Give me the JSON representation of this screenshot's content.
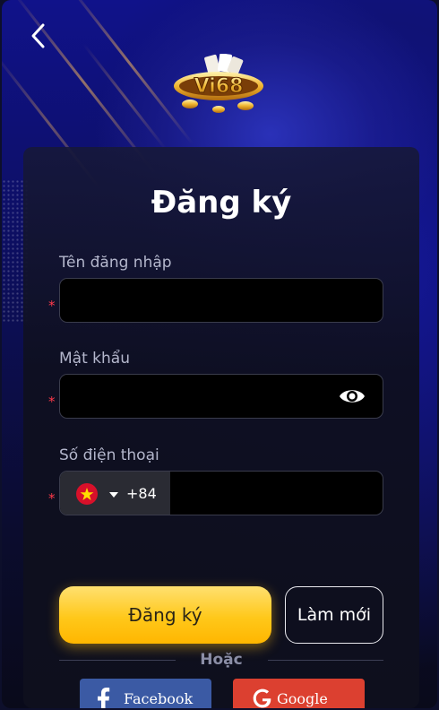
{
  "header": {
    "back_icon": "chevron-left-icon",
    "logo_text": "Vi68"
  },
  "form": {
    "title": "Đăng ký",
    "username": {
      "label": "Tên đăng nhập",
      "value": "",
      "placeholder": ""
    },
    "password": {
      "label": "Mật khẩu",
      "value": "",
      "placeholder": "",
      "toggle_icon": "eye-icon"
    },
    "phone": {
      "label": "Số điện thoại",
      "country_code": "+84",
      "flag": "vietnam-flag-icon",
      "value": "",
      "placeholder": ""
    },
    "required_mark": "*"
  },
  "actions": {
    "register_label": "Đăng ký",
    "reset_label": "Làm mới",
    "or_label": "Hoặc",
    "facebook_label": "Facebook",
    "google_label": "Google"
  },
  "colors": {
    "primary_button": "#ffc81a",
    "required": "#ff3a4a",
    "facebook": "#3b5aa4",
    "google": "#dc4030"
  }
}
